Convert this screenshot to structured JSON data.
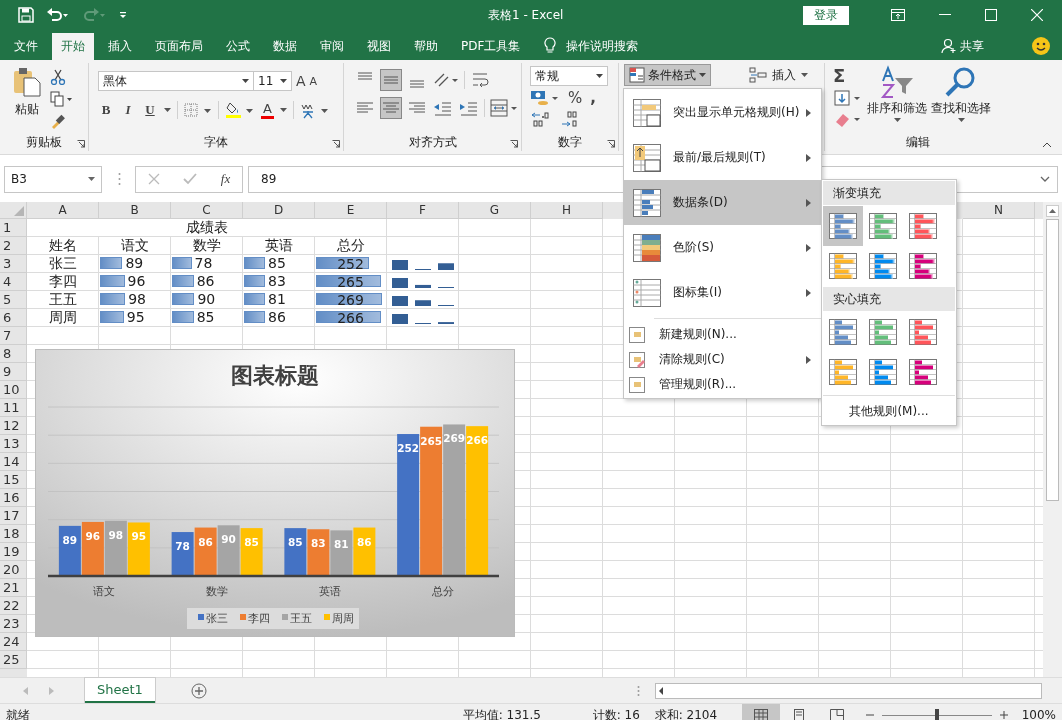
{
  "title_bar": {
    "title": "表格1  -  Excel",
    "sign_in": "登录"
  },
  "menu_tabs": [
    {
      "label": "文件",
      "selected": false
    },
    {
      "label": "开始",
      "selected": true
    },
    {
      "label": "插入",
      "selected": false
    },
    {
      "label": "页面布局",
      "selected": false
    },
    {
      "label": "公式",
      "selected": false
    },
    {
      "label": "数据",
      "selected": false
    },
    {
      "label": "审阅",
      "selected": false
    },
    {
      "label": "视图",
      "selected": false
    },
    {
      "label": "帮助",
      "selected": false
    },
    {
      "label": "PDF工具集",
      "selected": false
    }
  ],
  "tell_me": "操作说明搜索",
  "share": "共享",
  "ribbon": {
    "clipboard": {
      "paste": "粘贴",
      "label": "剪贴板"
    },
    "font": {
      "font_name": "黑体",
      "font_size": "11",
      "grow": "A",
      "shrink": "A",
      "styles": [
        "B",
        "I",
        "U"
      ],
      "font_color": "A",
      "label": "字体"
    },
    "alignment": {
      "label": "对齐方式"
    },
    "number": {
      "format": "常规",
      "percent": "%",
      "comma": ",",
      "label": "数字"
    },
    "styles": {
      "conditional_format": "条件格式",
      "insert": "插入"
    },
    "editing": {
      "sum": "Σ",
      "sort": "排序和筛选",
      "find": "查找和选择",
      "label": "编辑"
    }
  },
  "formula_bar": {
    "name_box": "B3",
    "fx": "fx",
    "formula": "89"
  },
  "columns": [
    "A",
    "B",
    "C",
    "D",
    "E",
    "F",
    "G",
    "H",
    "N"
  ],
  "row_numbers": [
    "1",
    "2",
    "3",
    "4",
    "5",
    "6",
    "7",
    "8",
    "9",
    "10",
    "11",
    "12",
    "13",
    "14",
    "15",
    "16",
    "17",
    "18",
    "19",
    "20",
    "21",
    "22",
    "23",
    "24",
    "25"
  ],
  "sheet": {
    "title": "成绩表",
    "headers": [
      "姓名",
      "语文",
      "数学",
      "英语",
      "总分"
    ],
    "rows": [
      {
        "name": "张三",
        "scores": [
          {
            "value": "89",
            "level": 0.32
          },
          {
            "value": "78",
            "level": 0.28
          },
          {
            "value": "85",
            "level": 0.3
          }
        ],
        "total": {
          "value": "252",
          "level": 0.76
        }
      },
      {
        "name": "李四",
        "scores": [
          {
            "value": "96",
            "level": 0.35
          },
          {
            "value": "86",
            "level": 0.31
          },
          {
            "value": "83",
            "level": 0.3
          }
        ],
        "total": {
          "value": "265",
          "level": 0.93
        }
      },
      {
        "name": "王五",
        "scores": [
          {
            "value": "98",
            "level": 0.36
          },
          {
            "value": "90",
            "level": 0.32
          },
          {
            "value": "81",
            "level": 0.3
          }
        ],
        "total": {
          "value": "269",
          "level": 0.94
        }
      },
      {
        "name": "周周",
        "scores": [
          {
            "value": "95",
            "level": 0.34
          },
          {
            "value": "85",
            "level": 0.31
          },
          {
            "value": "86",
            "level": 0.3
          }
        ],
        "total": {
          "value": "266",
          "level": 0.93
        }
      }
    ]
  },
  "chart": {
    "chart_data": {
      "type": "bar",
      "title": "图表标题",
      "categories": [
        "语文",
        "数学",
        "英语",
        "总分"
      ],
      "series": [
        {
          "name": "张三",
          "color": "#4472c4",
          "values": [
            89,
            78,
            85,
            252
          ]
        },
        {
          "name": "李四",
          "color": "#ed7d31",
          "values": [
            96,
            86,
            83,
            265
          ]
        },
        {
          "name": "王五",
          "color": "#a5a5a5",
          "values": [
            98,
            90,
            81,
            269
          ]
        },
        {
          "name": "周周",
          "color": "#ffc000",
          "values": [
            95,
            85,
            86,
            266
          ]
        }
      ],
      "ylim": [
        0,
        300
      ],
      "data_labels": true,
      "legend": "bottom"
    }
  },
  "cf_menu": {
    "items": [
      {
        "label": "突出显示单元格规则(H)",
        "kind": "large",
        "submenu": true,
        "selected": false
      },
      {
        "label": "最前/最后规则(T)",
        "kind": "large",
        "submenu": true,
        "selected": false
      },
      {
        "label": "数据条(D)",
        "kind": "large",
        "submenu": true,
        "selected": true
      },
      {
        "label": "色阶(S)",
        "kind": "large",
        "submenu": true,
        "selected": false
      },
      {
        "label": "图标集(I)",
        "kind": "large",
        "submenu": true,
        "selected": false
      },
      {
        "label": "新建规则(N)...",
        "kind": "small",
        "submenu": false,
        "selected": false
      },
      {
        "label": "清除规则(C)",
        "kind": "small",
        "submenu": true,
        "selected": false
      },
      {
        "label": "管理规则(R)...",
        "kind": "small",
        "submenu": false,
        "selected": false
      }
    ]
  },
  "databar_menu": {
    "sections": [
      {
        "heading": "渐变填充",
        "kind": "gradient",
        "swatches": [
          {
            "color": "#638ec6",
            "selected": true
          },
          {
            "color": "#63be7b",
            "selected": false
          },
          {
            "color": "#ff555a",
            "selected": false
          },
          {
            "color": "#ffb628",
            "selected": false
          },
          {
            "color": "#008aef",
            "selected": false
          },
          {
            "color": "#d6007b",
            "selected": false
          }
        ]
      },
      {
        "heading": "实心填充",
        "kind": "solid",
        "swatches": [
          {
            "color": "#638ec6",
            "selected": false
          },
          {
            "color": "#63be7b",
            "selected": false
          },
          {
            "color": "#ff555a",
            "selected": false
          },
          {
            "color": "#ffb628",
            "selected": false
          },
          {
            "color": "#008aef",
            "selected": false
          },
          {
            "color": "#d6007b",
            "selected": false
          }
        ]
      }
    ],
    "more": "其他规则(M)..."
  },
  "sheet_tabs": [
    {
      "label": "Sheet1",
      "selected": true
    }
  ],
  "status_bar": {
    "ready": "就绪",
    "average": "平均值: 131.5",
    "count": "计数: 16",
    "sum": "求和: 2104",
    "views": [
      {
        "kind": "normal",
        "selected": true
      },
      {
        "kind": "layout",
        "selected": false
      },
      {
        "kind": "break",
        "selected": false
      }
    ],
    "zoom_slider": {
      "level": 0.5
    },
    "zoom": "100%"
  }
}
